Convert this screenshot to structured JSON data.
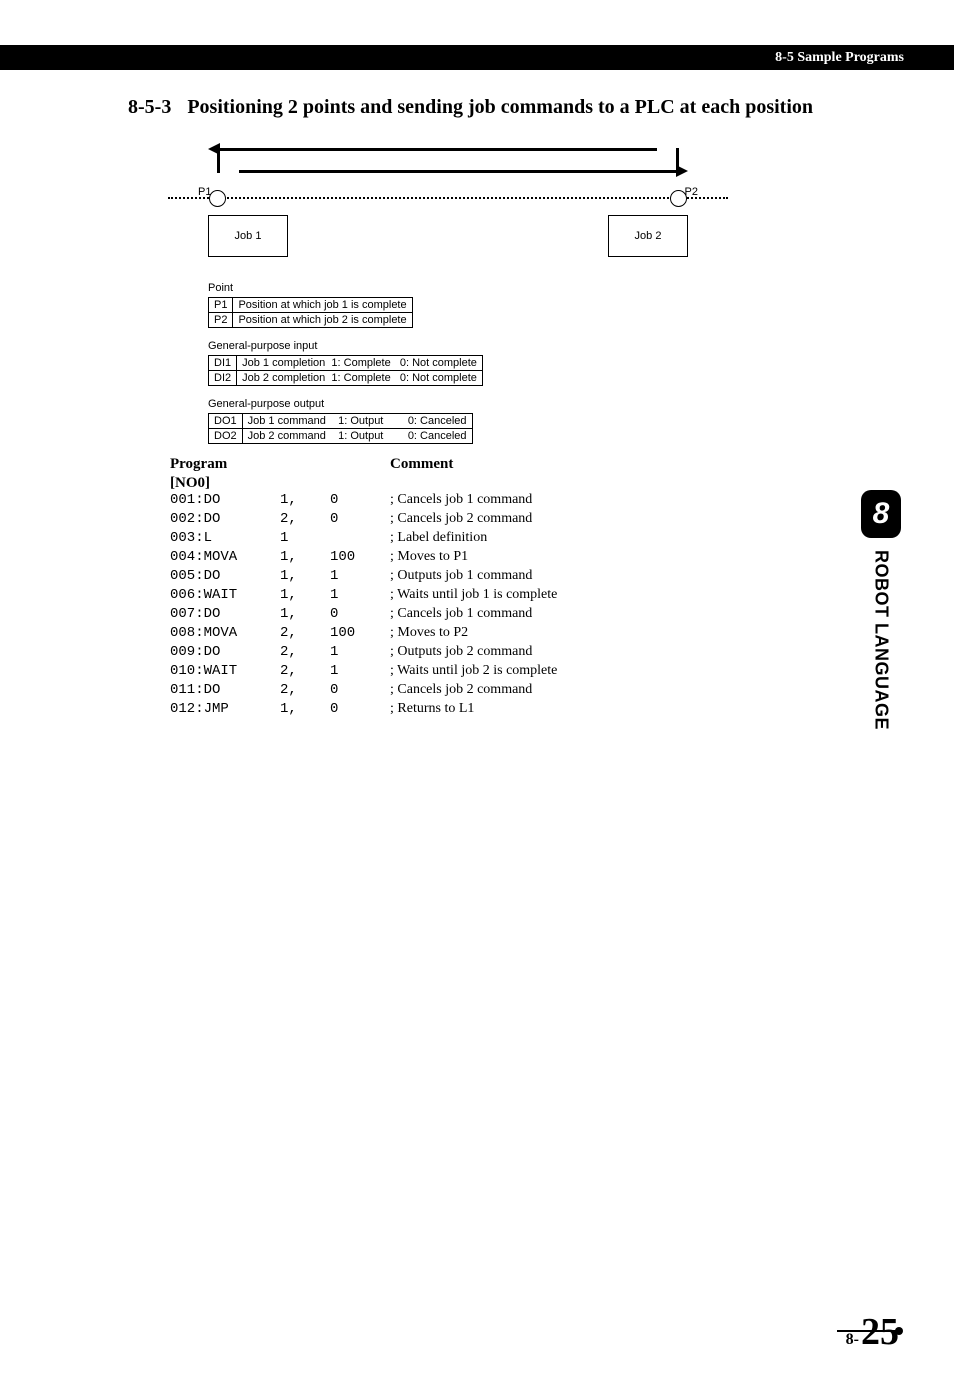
{
  "header": "8-5 Sample Programs",
  "section_num": "8-5-3",
  "section_text": "Positioning 2 points and sending job commands to a PLC at each position",
  "diagram": {
    "p1": "P1",
    "p2": "P2",
    "job1": "Job 1",
    "job2": "Job 2"
  },
  "tables": {
    "point_title": "Point",
    "point_rows": [
      [
        "P1",
        "Position at which job 1 is complete"
      ],
      [
        "P2",
        "Position at which job 2 is complete"
      ]
    ],
    "input_title": "General-purpose input",
    "input_rows": [
      [
        "DI1",
        "Job 1 completion  1: Complete   0: Not complete"
      ],
      [
        "DI2",
        "Job 2 completion  1: Complete   0: Not complete"
      ]
    ],
    "output_title": "General-purpose output",
    "output_rows": [
      [
        "DO1",
        "Job 1 command    1: Output        0: Canceled"
      ],
      [
        "DO2",
        "Job 2 command    1: Output        0: Canceled"
      ]
    ]
  },
  "program_header": "Program",
  "comment_header": "Comment",
  "program_label": "[NO0]",
  "code": [
    {
      "l": "001:DO",
      "a1": "1,",
      "a2": "0",
      "c": "; Cancels job 1 command"
    },
    {
      "l": "002:DO",
      "a1": "2,",
      "a2": "0",
      "c": "; Cancels job 2 command"
    },
    {
      "l": "003:L",
      "a1": "1",
      "a2": "",
      "c": "; Label definition"
    },
    {
      "l": "004:MOVA",
      "a1": "1,",
      "a2": "100",
      "c": "; Moves to P1"
    },
    {
      "l": "005:DO",
      "a1": "1,",
      "a2": "1",
      "c": "; Outputs job 1 command"
    },
    {
      "l": "006:WAIT",
      "a1": "1,",
      "a2": "1",
      "c": "; Waits until job 1 is complete"
    },
    {
      "l": "007:DO",
      "a1": "1,",
      "a2": "0",
      "c": "; Cancels job 1 command"
    },
    {
      "l": "008:MOVA",
      "a1": "2,",
      "a2": "100",
      "c": "; Moves to P2"
    },
    {
      "l": "009:DO",
      "a1": "2,",
      "a2": "1",
      "c": "; Outputs job 2 command"
    },
    {
      "l": "010:WAIT",
      "a1": "2,",
      "a2": "1",
      "c": "; Waits until job 2 is complete"
    },
    {
      "l": "011:DO",
      "a1": "2,",
      "a2": "0",
      "c": "; Cancels job 2 command"
    },
    {
      "l": "012:JMP",
      "a1": "1,",
      "a2": "0",
      "c": "; Returns to L1"
    }
  ],
  "side_tab_num": "8",
  "side_tab_text": "ROBOT LANGUAGE",
  "page_prefix": "8-",
  "page_number": "25"
}
